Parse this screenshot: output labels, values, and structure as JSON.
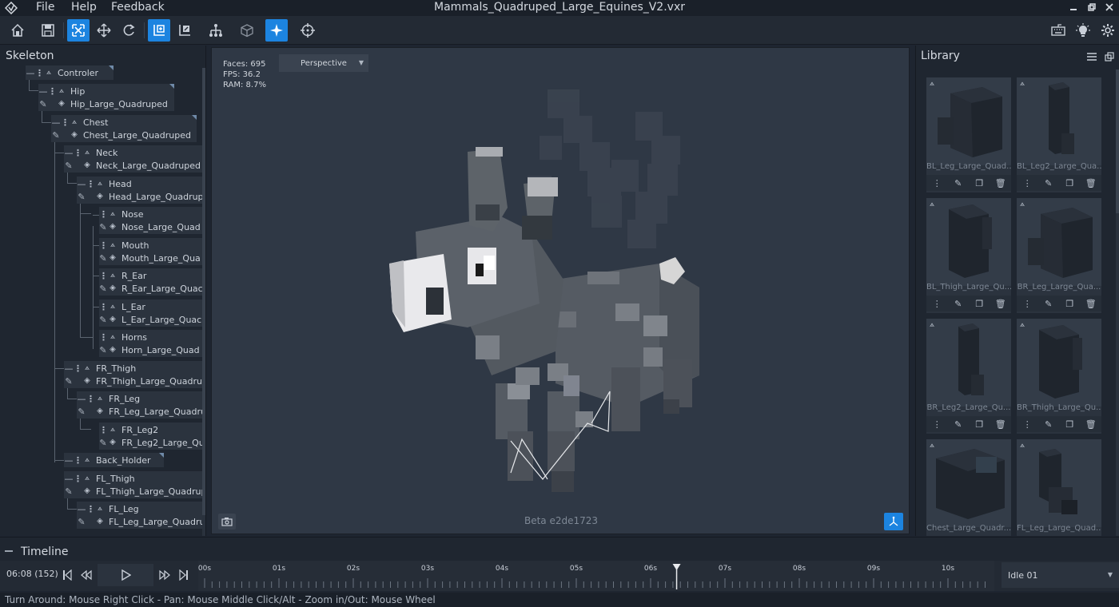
{
  "window": {
    "title": "Mammals_Quadruped_Large_Equines_V2.vxr",
    "menu": [
      "File",
      "Help",
      "Feedback"
    ]
  },
  "toolbar": {
    "left_buttons": [
      {
        "icon": "home-icon"
      },
      {
        "icon": "save-icon"
      },
      {
        "icon": "select-bounds-icon",
        "active": true
      },
      {
        "icon": "move-icon"
      },
      {
        "icon": "rotate-icon"
      },
      {
        "icon": "bone-add-icon",
        "active": true
      },
      {
        "icon": "bone-edit-icon"
      },
      {
        "icon": "hierarchy-icon"
      },
      {
        "icon": "cube-icon"
      },
      {
        "icon": "sparkle-icon",
        "active": true
      },
      {
        "icon": "crosshair-icon"
      }
    ],
    "right_buttons": [
      {
        "icon": "keyboard-icon"
      },
      {
        "icon": "lightbulb-icon"
      },
      {
        "icon": "settings-icon"
      }
    ]
  },
  "skeleton": {
    "title": "Skeleton",
    "nodes": [
      {
        "bone": "Controler",
        "mesh": ""
      },
      {
        "bone": "Hip",
        "mesh": "Hip_Large_Quadruped"
      },
      {
        "bone": "Chest",
        "mesh": "Chest_Large_Quadruped"
      },
      {
        "bone": "Neck",
        "mesh": "Neck_Large_Quadruped"
      },
      {
        "bone": "Head",
        "mesh": "Head_Large_Quadrup"
      },
      {
        "bone": "Nose",
        "mesh": "Nose_Large_Quad"
      },
      {
        "bone": "Mouth",
        "mesh": "Mouth_Large_Qua"
      },
      {
        "bone": "R_Ear",
        "mesh": "R_Ear_Large_Quac"
      },
      {
        "bone": "L_Ear",
        "mesh": "L_Ear_Large_Quac"
      },
      {
        "bone": "Horns",
        "mesh": "Horn_Large_Quad"
      },
      {
        "bone": "FR_Thigh",
        "mesh": "FR_Thigh_Large_Quadrup"
      },
      {
        "bone": "FR_Leg",
        "mesh": "FR_Leg_Large_Quadru"
      },
      {
        "bone": "FR_Leg2",
        "mesh": "FR_Leg2_Large_Qu"
      },
      {
        "bone": "Back_Holder",
        "mesh": ""
      },
      {
        "bone": "FL_Thigh",
        "mesh": "FL_Thigh_Large_Quadrup"
      },
      {
        "bone": "FL_Leg",
        "mesh": "FL_Leg_Large_Quadru"
      }
    ]
  },
  "viewport": {
    "stats": {
      "faces": "Faces: 695",
      "fps": "FPS: 36.2",
      "ram": "RAM: 8.7%"
    },
    "view_mode": "Perspective",
    "version": "Beta e2de1723"
  },
  "library": {
    "title": "Library",
    "items": [
      {
        "name": "BL_Leg_Large_Quad...",
        "shape": "block"
      },
      {
        "name": "BL_Leg2_Large_Qua...",
        "shape": "tall"
      },
      {
        "name": "BL_Thigh_Large_Qu...",
        "shape": "thigh"
      },
      {
        "name": "BR_Leg_Large_Qua...",
        "shape": "block"
      },
      {
        "name": "BR_Leg2_Large_Qu...",
        "shape": "tall"
      },
      {
        "name": "BR_Thigh_Large_Qu...",
        "shape": "thigh"
      },
      {
        "name": "Chest_Large_Quadr...",
        "shape": "chest"
      },
      {
        "name": "FL_Leg_Large_Quad...",
        "shape": "leg"
      }
    ]
  },
  "timeline": {
    "title": "Timeline",
    "current_time": "06:08 (152)",
    "ticks": [
      "00s",
      "01s",
      "02s",
      "03s",
      "04s",
      "05s",
      "06s",
      "07s",
      "08s",
      "09s",
      "10s"
    ],
    "playhead_seconds": 6.35,
    "animation": "Idle 01"
  },
  "status": {
    "text": "Turn Around: Mouse Right Click - Pan: Mouse Middle Click/Alt - Zoom in/Out: Mouse Wheel"
  },
  "colors": {
    "accent": "#1c84e0",
    "background": "#1e2530",
    "panel": "#1f2630",
    "viewport": "#2f3845"
  }
}
